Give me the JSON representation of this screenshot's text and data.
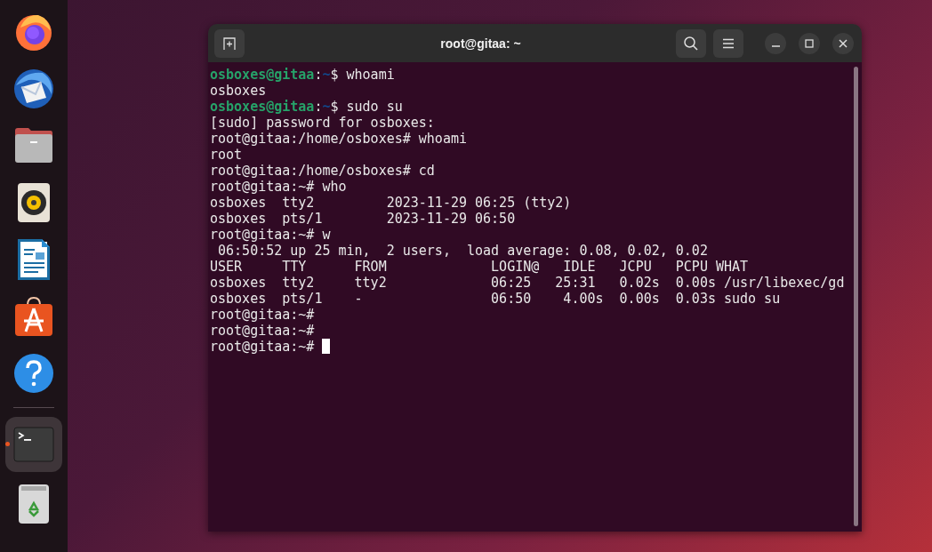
{
  "dock": {
    "items": [
      {
        "kind": "firefox",
        "selected": false,
        "running": false
      },
      {
        "kind": "thunderbird",
        "selected": false,
        "running": false
      },
      {
        "kind": "files",
        "selected": false,
        "running": false
      },
      {
        "kind": "rhythmbox",
        "selected": false,
        "running": false
      },
      {
        "kind": "writer",
        "selected": false,
        "running": false
      },
      {
        "kind": "software",
        "selected": false,
        "running": false
      },
      {
        "kind": "help",
        "selected": false,
        "running": false
      },
      {
        "kind": "terminal",
        "selected": true,
        "running": true
      },
      {
        "kind": "trash",
        "selected": false,
        "running": false
      }
    ]
  },
  "window": {
    "title": "root@gitaa: ~"
  },
  "terminal": {
    "lines": [
      {
        "kind": "prompt",
        "user_host": "osboxes@gitaa",
        "separator": ":",
        "path": "~",
        "command": "$ whoami",
        "cursor": false
      },
      {
        "kind": "output",
        "text": "osboxes",
        "cursor": false
      },
      {
        "kind": "prompt",
        "user_host": "osboxes@gitaa",
        "separator": ":",
        "path": "~",
        "command": "$ sudo su",
        "cursor": false
      },
      {
        "kind": "output",
        "text": "[sudo] password for osboxes:",
        "cursor": false
      },
      {
        "kind": "output",
        "text": "root@gitaa:/home/osboxes# whoami",
        "cursor": false
      },
      {
        "kind": "output",
        "text": "root",
        "cursor": false
      },
      {
        "kind": "output",
        "text": "root@gitaa:/home/osboxes# cd",
        "cursor": false
      },
      {
        "kind": "output",
        "text": "root@gitaa:~# who",
        "cursor": false
      },
      {
        "kind": "output",
        "text": "osboxes  tty2         2023-11-29 06:25 (tty2)",
        "cursor": false
      },
      {
        "kind": "output",
        "text": "osboxes  pts/1        2023-11-29 06:50",
        "cursor": false
      },
      {
        "kind": "output",
        "text": "root@gitaa:~# w",
        "cursor": false
      },
      {
        "kind": "output",
        "text": " 06:50:52 up 25 min,  2 users,  load average: 0.08, 0.02, 0.02",
        "cursor": false
      },
      {
        "kind": "output",
        "text": "USER     TTY      FROM             LOGIN@   IDLE   JCPU   PCPU WHAT",
        "cursor": false
      },
      {
        "kind": "output",
        "text": "osboxes  tty2     tty2             06:25   25:31   0.02s  0.00s /usr/libexec/gd",
        "cursor": false
      },
      {
        "kind": "output",
        "text": "osboxes  pts/1    -                06:50    4.00s  0.00s  0.03s sudo su",
        "cursor": false
      },
      {
        "kind": "output",
        "text": "root@gitaa:~#",
        "cursor": false
      },
      {
        "kind": "output",
        "text": "root@gitaa:~#",
        "cursor": false
      },
      {
        "kind": "output",
        "text": "root@gitaa:~# ",
        "cursor": true
      }
    ]
  }
}
